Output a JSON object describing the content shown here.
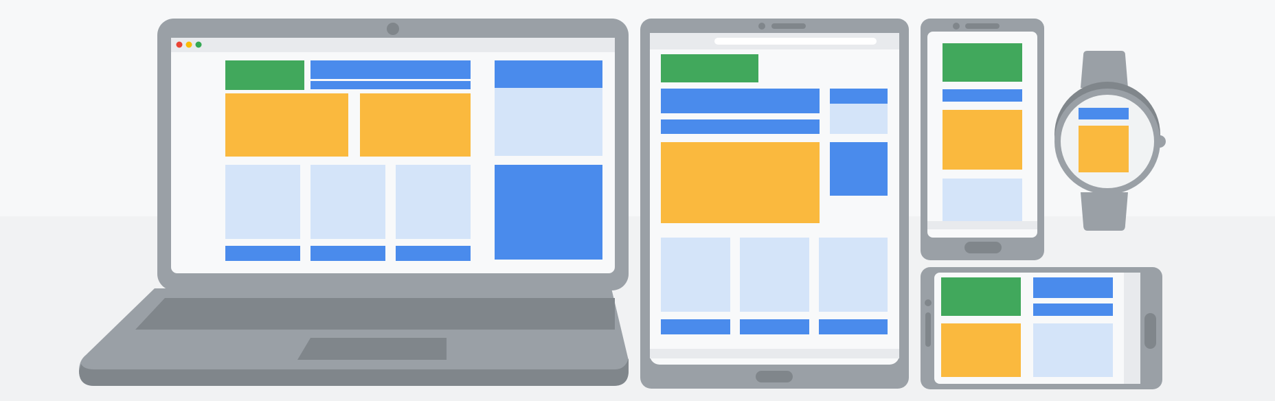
{
  "colors": {
    "background_top": "#f7f8f9",
    "background_bottom": "#f1f2f3",
    "device_body": "#9aa0a6",
    "device_dark": "#80868b",
    "screen_bg": "#f8f9fa",
    "screen_bar": "#e8eaed",
    "tile_green": "#41a85c",
    "tile_blue": "#4a8bec",
    "tile_yellow": "#fab93e",
    "tile_light_blue": "#d4e4f9",
    "window_dot_red": "#ea4335",
    "window_dot_yellow": "#fbbc04",
    "window_dot_green": "#34a853"
  },
  "devices": [
    "laptop",
    "tablet",
    "phone-portrait",
    "smartwatch",
    "phone-landscape"
  ]
}
